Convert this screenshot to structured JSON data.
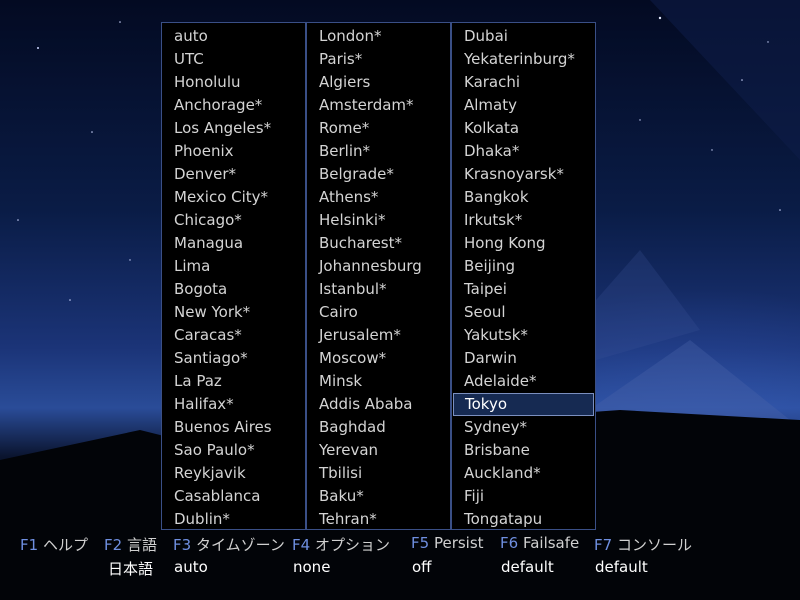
{
  "timezones": {
    "columns": [
      [
        "auto",
        "UTC",
        "Honolulu",
        "Anchorage*",
        "Los Angeles*",
        "Phoenix",
        "Denver*",
        "Mexico City*",
        "Chicago*",
        "Managua",
        "Lima",
        "Bogota",
        "New York*",
        "Caracas*",
        "Santiago*",
        "La Paz",
        "Halifax*",
        "Buenos Aires",
        "Sao Paulo*",
        "Reykjavik",
        "Casablanca",
        "Dublin*"
      ],
      [
        "London*",
        "Paris*",
        "Algiers",
        "Amsterdam*",
        "Rome*",
        "Berlin*",
        "Belgrade*",
        "Athens*",
        "Helsinki*",
        "Bucharest*",
        "Johannesburg",
        "Istanbul*",
        "Cairo",
        "Jerusalem*",
        "Moscow*",
        "Minsk",
        "Addis Ababa",
        "Baghdad",
        "Yerevan",
        "Tbilisi",
        "Baku*",
        "Tehran*"
      ],
      [
        "Dubai",
        "Yekaterinburg*",
        "Karachi",
        "Almaty",
        "Kolkata",
        "Dhaka*",
        "Krasnoyarsk*",
        "Bangkok",
        "Irkutsk*",
        "Hong Kong",
        "Beijing",
        "Taipei",
        "Seoul",
        "Yakutsk*",
        "Darwin",
        "Adelaide*",
        "Tokyo",
        "Sydney*",
        "Brisbane",
        "Auckland*",
        "Fiji",
        "Tongatapu"
      ]
    ],
    "selected": "Tokyo"
  },
  "function_keys": [
    {
      "key": "F1",
      "label": "ヘルプ",
      "value": ""
    },
    {
      "key": "F2",
      "label": "言語",
      "value": "日本語"
    },
    {
      "key": "F3",
      "label": "タイムゾーン",
      "value": "auto"
    },
    {
      "key": "F4",
      "label": "オプション",
      "value": "none"
    },
    {
      "key": "F5",
      "label": "Persist",
      "value": "off"
    },
    {
      "key": "F6",
      "label": "Failsafe",
      "value": "default"
    },
    {
      "key": "F7",
      "label": "コンソール",
      "value": "default"
    }
  ],
  "colors": {
    "key_accent": "#6f8fe0",
    "selected_bg": "#162a52",
    "panel_border": "#3a4f86"
  }
}
